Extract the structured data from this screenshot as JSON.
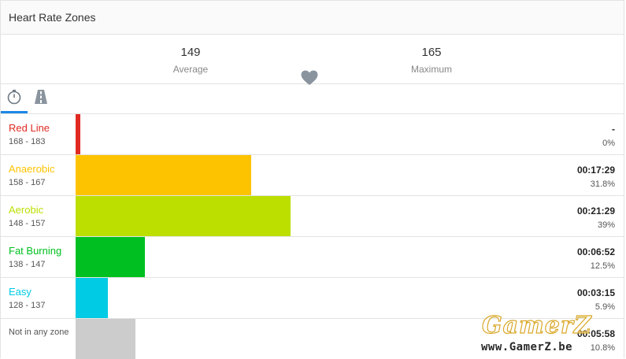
{
  "header": {
    "title": "Heart Rate Zones"
  },
  "summary": {
    "average_value": "149",
    "average_label": "Average",
    "maximum_value": "165",
    "maximum_label": "Maximum",
    "heart_icon": "heart-icon",
    "icon_color": "#8a949e"
  },
  "tabs": [
    {
      "icon": "stopwatch-icon",
      "active": true
    },
    {
      "icon": "road-icon",
      "active": false
    }
  ],
  "accent_color": "#1e88e5",
  "zones": [
    {
      "name": "Red Line",
      "range": "168 - 183",
      "time": "-",
      "percent": "0%",
      "fraction": 0.0,
      "color": "#e02b23"
    },
    {
      "name": "Anaerobic",
      "range": "158 - 167",
      "time": "00:17:29",
      "percent": "31.8%",
      "fraction": 0.318,
      "color": "#fec300"
    },
    {
      "name": "Aerobic",
      "range": "148 - 157",
      "time": "00:21:29",
      "percent": "39%",
      "fraction": 0.39,
      "color": "#bddf00"
    },
    {
      "name": "Fat Burning",
      "range": "138 - 147",
      "time": "00:06:52",
      "percent": "12.5%",
      "fraction": 0.125,
      "color": "#00c021"
    },
    {
      "name": "Easy",
      "range": "128 - 137",
      "time": "00:03:15",
      "percent": "5.9%",
      "fraction": 0.059,
      "color": "#00cbe4"
    },
    {
      "name": "Not in any zone",
      "range": "",
      "time": "00:05:58",
      "percent": "10.8%",
      "fraction": 0.108,
      "color": "#cccccc"
    }
  ],
  "watermark": {
    "logo": "GamerZ",
    "url": "www.GamerZ.be"
  }
}
